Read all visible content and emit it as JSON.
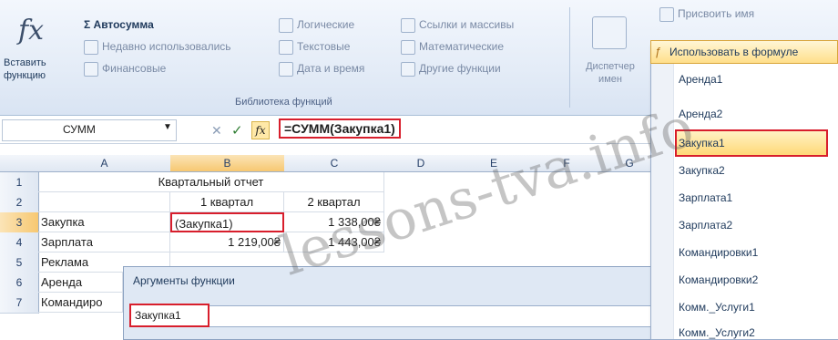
{
  "ribbon": {
    "insert_function_label": "Вставить функцию",
    "autosum": "Σ Автосумма",
    "recent": "Недавно использовались",
    "financial": "Финансовые",
    "logical": "Логические",
    "text": "Текстовые",
    "datetime": "Дата и время",
    "lookup": "Ссылки и массивы",
    "math": "Математические",
    "other": "Другие функции",
    "library_label": "Библиотека функций",
    "name_manager": "Диспетчер имен",
    "assign_name": "Присвоить имя",
    "use_in_formula": "Использовать в формуле"
  },
  "formula_bar": {
    "name_box": "СУММ",
    "formula": "=СУММ(Закупка1)"
  },
  "sheet": {
    "columns": [
      "A",
      "B",
      "C",
      "D",
      "E",
      "F",
      "G"
    ],
    "rows": [
      "1",
      "2",
      "3",
      "4",
      "5",
      "6",
      "7"
    ],
    "title": "Квартальный отчет",
    "q1": "1 квартал",
    "q2": "2 квартал",
    "r3a": "Закупка",
    "r3b": "(Закупка1)",
    "r3c": "1 338,00₴",
    "r4a": "Зарплата",
    "r4b": "1 219,00₴",
    "r4c": "1 443,00₴",
    "r5a": "Реклама",
    "r6a": "Аренда",
    "r7a": "Командиро"
  },
  "dialog": {
    "title": "Аргументы функции",
    "value": "Закупка1"
  },
  "dropdown": {
    "items": [
      "Аренда1",
      "Аренда2",
      "Закупка1",
      "Закупка2",
      "Зарплата1",
      "Зарплата2",
      "Командировки1",
      "Командировки2",
      "Комм._Услуги1",
      "Комм._Услуги2"
    ]
  },
  "watermark": "lessons-tva.info"
}
